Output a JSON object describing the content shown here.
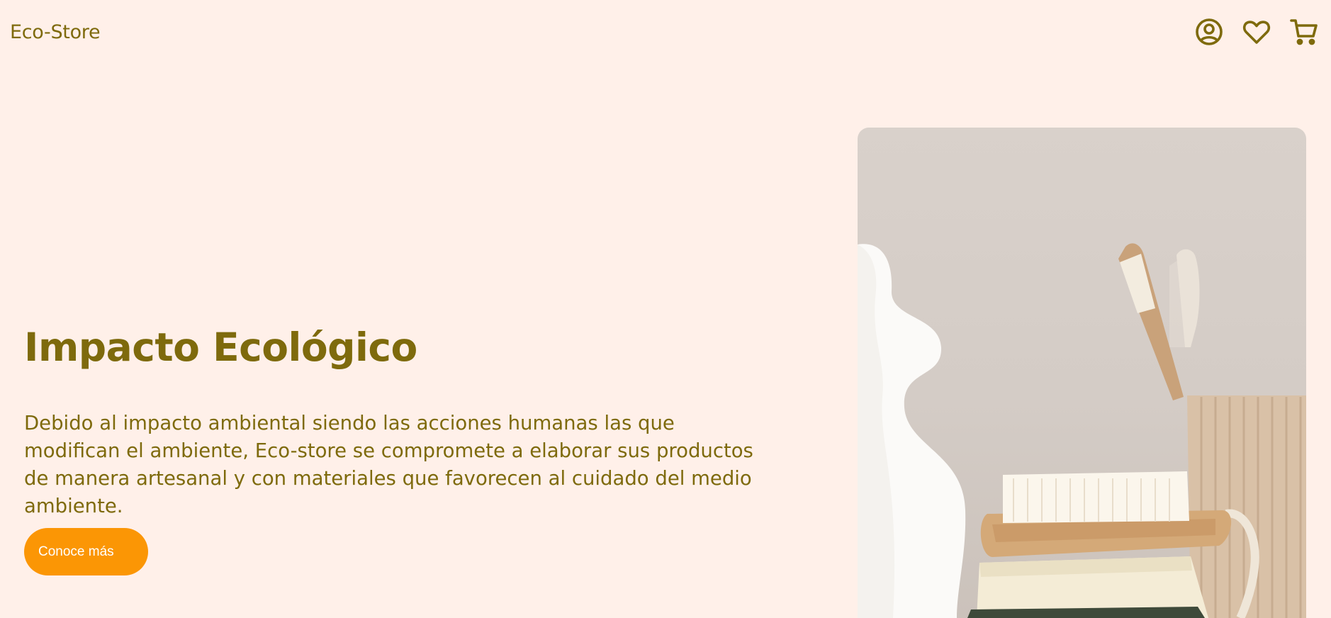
{
  "header": {
    "brand": "Eco-Store",
    "icons": {
      "account": "user-circle-icon",
      "wishlist": "heart-icon",
      "cart": "shopping-cart-icon"
    }
  },
  "hero": {
    "title": "Impacto Ecológico",
    "description": "Debido al impacto ambiental siendo las acciones humanas las que modifican el ambiente, Eco-store se compromete a elaborar sus productos de manera artesanal y con materiales que favorecen al cuidado del medio ambiente.",
    "cta_label": "Conoce más"
  },
  "colors": {
    "background": "#FFF0E9",
    "brand_text": "#7E6A0C",
    "accent": "#FB9605",
    "button_text": "#FFFFFF"
  }
}
